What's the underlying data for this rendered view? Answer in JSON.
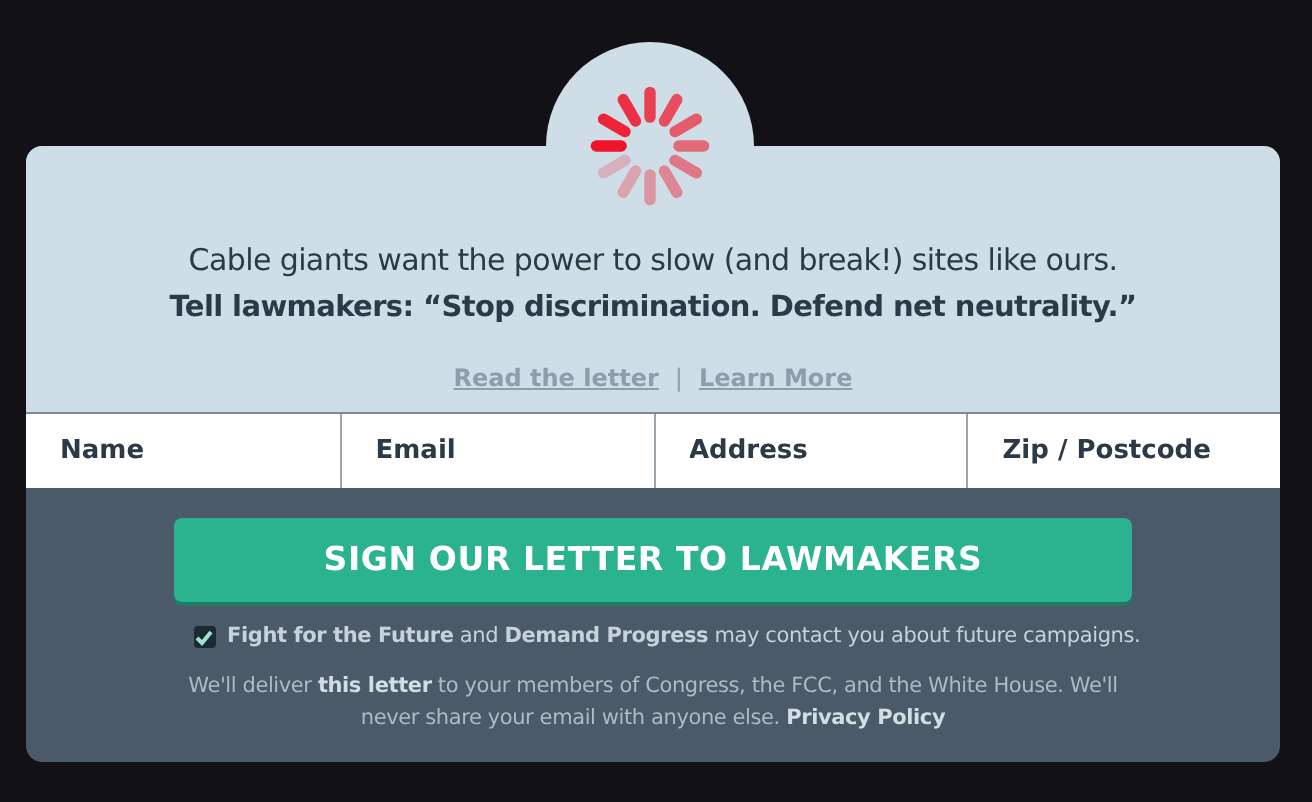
{
  "headline": "Cable giants want the power to slow (and break!) sites like ours.",
  "subheadline": "Tell lawmakers: “Stop discrimination. Defend net neutrality.”",
  "links": [
    {
      "label": "Read the letter"
    },
    {
      "label": "Learn More"
    }
  ],
  "separator": "|",
  "fields": [
    {
      "placeholder": "Name"
    },
    {
      "placeholder": "Email"
    },
    {
      "placeholder": "Address"
    },
    {
      "placeholder": "Zip / Postcode"
    }
  ],
  "submit": "SIGN OUR LETTER TO LAWMAKERS",
  "consent": {
    "checked": true,
    "text": "**Fight for the Future** and **Demand Progress** may contact you about future campaigns."
  },
  "notice": [
    {
      "kind": "text",
      "text": "We'll deliver "
    },
    {
      "kind": "link",
      "text": "this letter"
    },
    {
      "kind": "text",
      "text": " to your members of Congress, the FCC, and the White House. We'll never share your email with anyone else. "
    },
    {
      "kind": "link",
      "text": "Privacy Policy"
    }
  ]
}
